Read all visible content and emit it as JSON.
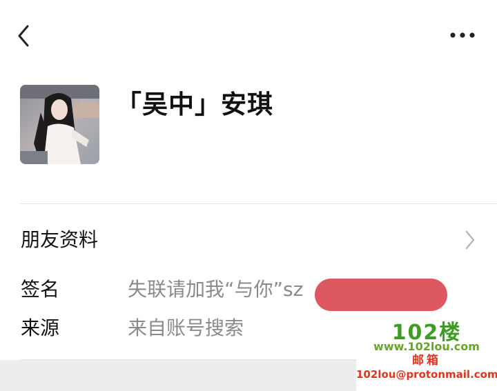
{
  "header": {
    "back_icon": "chevron-left-icon",
    "more_icon": "more-horizontal-icon"
  },
  "profile": {
    "name": "「吴中」安琪",
    "avatar": "avatar-photo"
  },
  "friend_info": {
    "label": "朋友资料",
    "icon": "chevron-right-icon"
  },
  "signature": {
    "label": "签名",
    "value": "失联请加我“与你”sz"
  },
  "source": {
    "label": "来源",
    "value": "来自账号搜索"
  },
  "watermark": {
    "logo": "102楼",
    "site": "www.102lou.com",
    "mailbox": "邮箱",
    "email": "102lou@protonmail.com"
  },
  "colors": {
    "redaction": "#dd5860",
    "watermark_green": "#3d9c21",
    "watermark_red": "#e0351e"
  }
}
